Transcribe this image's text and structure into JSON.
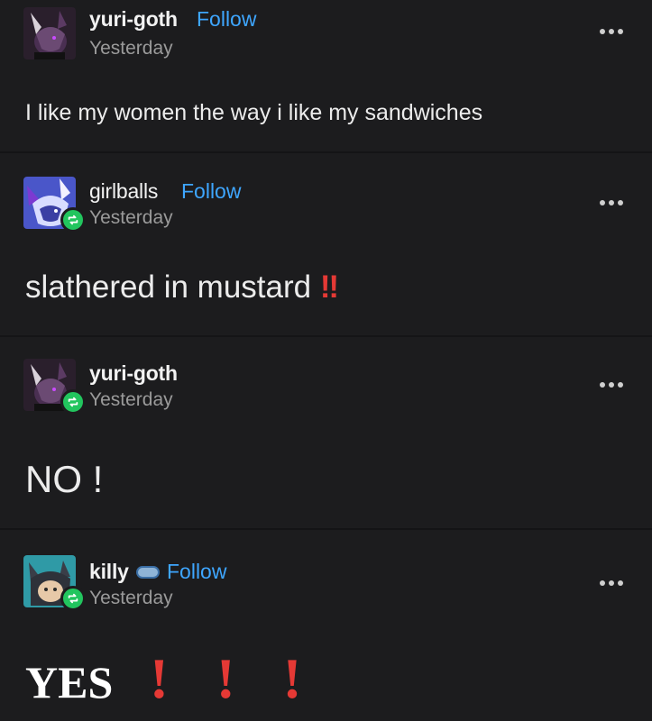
{
  "posts": [
    {
      "username": "yuri-goth",
      "follow_label": "Follow",
      "timestamp": "Yesterday",
      "text": "I like my women the way i like my sandwiches",
      "reblog": false
    },
    {
      "username": "girlballs",
      "follow_label": "Follow",
      "timestamp": "Yesterday",
      "text": "slathered in mustard",
      "emphasis": "‼",
      "reblog": true
    },
    {
      "username": "yuri-goth",
      "timestamp": "Yesterday",
      "text": "NO !",
      "reblog": true
    },
    {
      "username": "killy",
      "follow_label": "Follow",
      "timestamp": "Yesterday",
      "text": "YES",
      "emphasis": [
        "!",
        "!",
        "!"
      ],
      "reblog": true
    }
  ],
  "colors": {
    "background": "#1c1c1e",
    "follow": "#3ea6ff",
    "reblog_badge": "#22c55e",
    "emphasis": "#e53935",
    "timestamp": "#9a9a9a"
  },
  "icons": [
    "avatar-image",
    "reblog-icon",
    "more-options-icon",
    "ticket-badge-icon"
  ]
}
